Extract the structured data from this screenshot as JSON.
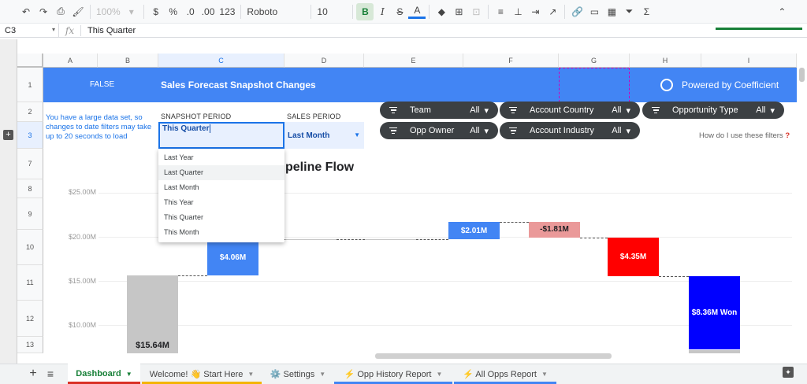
{
  "toolbar": {
    "zoom": "100%",
    "currency": "$",
    "percent": "%",
    "dec_decrease": ".0",
    "dec_increase": ".00",
    "more_formats": "123",
    "font": "Roboto",
    "font_size": "10",
    "bold": "B",
    "italic": "I",
    "text_color": "A"
  },
  "formula_bar": {
    "cell_ref": "C3",
    "fx": "fx",
    "value": "This Quarter"
  },
  "columns": [
    "A",
    "B",
    "C",
    "D",
    "E",
    "F",
    "G",
    "H",
    "I"
  ],
  "rows": [
    "1",
    "2",
    "3",
    "7",
    "8",
    "9",
    "10",
    "11",
    "12",
    "13"
  ],
  "banner": {
    "flag": "FALSE",
    "title": "Sales Forecast Snapshot Changes",
    "powered": "Powered by Coefficient"
  },
  "note": "You have a large data set, so changes to date filters may take up to 20 seconds to load",
  "snapshot": {
    "label": "SNAPSHOT PERIOD",
    "value": "This Quarter",
    "options": [
      "Last Year",
      "Last Quarter",
      "Last Month",
      "This Year",
      "This Quarter",
      "This Month"
    ]
  },
  "sales_period": {
    "label": "SALES PERIOD",
    "value": "Last Month"
  },
  "filters": [
    {
      "label": "Team",
      "value": "All"
    },
    {
      "label": "Account Country",
      "value": "All"
    },
    {
      "label": "Opportunity Type",
      "value": "All"
    },
    {
      "label": "Opp Owner",
      "value": "All"
    },
    {
      "label": "Account Industry",
      "value": "All"
    }
  ],
  "help_text": "How do I use these filters",
  "help_mark": "?",
  "chart_data": {
    "type": "bar",
    "title": "peline Flow",
    "yticks": [
      "$25.00M",
      "$20.00M",
      "$15.00M",
      "$10.00M"
    ],
    "ylim": [
      10,
      25
    ],
    "bars": [
      {
        "label": "$15.64M",
        "start": 0,
        "end": 15.64,
        "color": "#c6c6c6"
      },
      {
        "label": "$4.06M",
        "start": 15.64,
        "end": 19.7,
        "color": "#4285f4"
      },
      {
        "label": "",
        "start": 19.7,
        "end": 19.7,
        "color": "#c6c6c6"
      },
      {
        "label": "",
        "start": 19.7,
        "end": 19.7,
        "color": "#c6c6c6"
      },
      {
        "label": "$2.01M",
        "start": 19.7,
        "end": 21.71,
        "color": "#4285f4"
      },
      {
        "label": "-$1.81M",
        "start": 21.71,
        "end": 19.9,
        "color": "#ea9999"
      },
      {
        "label": "$4.35M",
        "start": 19.9,
        "end": 15.55,
        "color": "#ff0000"
      },
      {
        "label": "$8.36M Won",
        "start": 15.55,
        "end": 7.19,
        "color": "#0000ff"
      }
    ]
  },
  "tabs": [
    {
      "label": "Dashboard",
      "color": "#188038"
    },
    {
      "label": "Welcome! 👋 Start Here",
      "color": "#f4b400"
    },
    {
      "label": "⚙️ Settings",
      "color": ""
    },
    {
      "label": "⚡ Opp History Report",
      "color": "#4285f4"
    },
    {
      "label": "⚡ All Opps Report",
      "color": "#4285f4"
    }
  ]
}
